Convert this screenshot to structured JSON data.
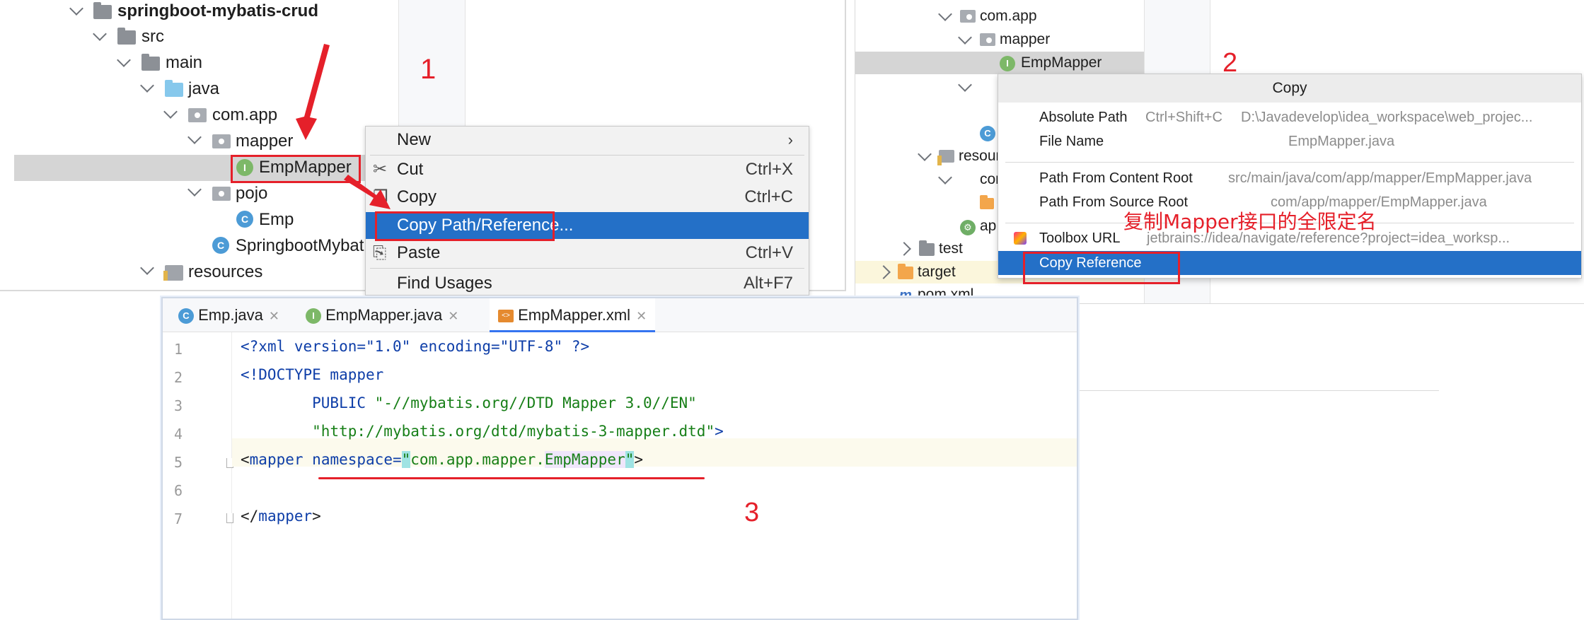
{
  "panel1": {
    "tree": [
      {
        "label": "springboot-mybatis-crud",
        "bold": true
      },
      {
        "label": "src"
      },
      {
        "label": "main"
      },
      {
        "label": "java"
      },
      {
        "label": "com.app"
      },
      {
        "label": "mapper"
      },
      {
        "label": "EmpMapper"
      },
      {
        "label": "pojo"
      },
      {
        "label": "Emp"
      },
      {
        "label": "SpringbootMybat"
      },
      {
        "label": "resources"
      }
    ],
    "context_menu": [
      {
        "label": "New",
        "shortcut": ""
      },
      {
        "label": "Cut",
        "shortcut": "Ctrl+X"
      },
      {
        "label": "Copy",
        "shortcut": "Ctrl+C"
      },
      {
        "label": "Copy Path/Reference...",
        "shortcut": ""
      },
      {
        "label": "Paste",
        "shortcut": "Ctrl+V"
      },
      {
        "label": "Find Usages",
        "shortcut": "Alt+F7"
      }
    ],
    "step_number": "1"
  },
  "panel2": {
    "tree": [
      {
        "label": "com.app"
      },
      {
        "label": "mapper"
      },
      {
        "label": "EmpMapper"
      },
      {
        "label": "resour"
      },
      {
        "label": "cor"
      },
      {
        "label": "ap"
      },
      {
        "label": "test"
      },
      {
        "label": "target"
      },
      {
        "label": "pom.xml"
      }
    ],
    "copy_popup": {
      "title": "Copy",
      "items": [
        {
          "label": "Absolute Path",
          "shortcut": "Ctrl+Shift+C",
          "value": "D:\\Javadevelop\\idea_workspace\\web_projec..."
        },
        {
          "label": "File Name",
          "shortcut": "",
          "value": "EmpMapper.java"
        },
        {
          "label": "Path From Content Root",
          "shortcut": "",
          "value": "src/main/java/com/app/mapper/EmpMapper.java"
        },
        {
          "label": "Path From Source Root",
          "shortcut": "",
          "value": "com/app/mapper/EmpMapper.java"
        },
        {
          "label": "Toolbox URL",
          "shortcut": "",
          "value": "jetbrains://idea/navigate/reference?project=idea_worksp..."
        },
        {
          "label": "Copy Reference",
          "shortcut": "",
          "value": ""
        }
      ]
    },
    "step_number": "2",
    "annotation": "复制Mapper接口的全限定名"
  },
  "editor": {
    "tabs": [
      {
        "label": "Emp.java",
        "icon": "class-icon"
      },
      {
        "label": "EmpMapper.java",
        "icon": "interface-icon"
      },
      {
        "label": "EmpMapper.xml",
        "icon": "xml-icon"
      }
    ],
    "line_numbers": [
      "1",
      "2",
      "3",
      "4",
      "5",
      "6",
      "7"
    ],
    "lines": {
      "l1": {
        "a": "<?",
        "b": "xml version=\"1.0\" encoding=\"UTF-8\"",
        "c": " ?>"
      },
      "l2": {
        "a": "<!DOCTYPE mapper"
      },
      "l3": {
        "a": "        PUBLIC ",
        "b": "\"-//mybatis.org//DTD Mapper 3.0//EN\""
      },
      "l4": {
        "a": "        ",
        "b": "\"http://mybatis.org/dtd/mybatis-3-mapper.dtd\"",
        "c": ">"
      },
      "l5": {
        "a": "<",
        "b": "mapper",
        "c": " ",
        "d": "namespace=",
        "e": "\"",
        "f": "com.app.mapper.",
        "g": "EmpMapper",
        "h": "\"",
        "i": ">"
      },
      "l7": {
        "a": "</",
        "b": "mapper",
        "c": ">"
      }
    },
    "step_number": "3"
  }
}
